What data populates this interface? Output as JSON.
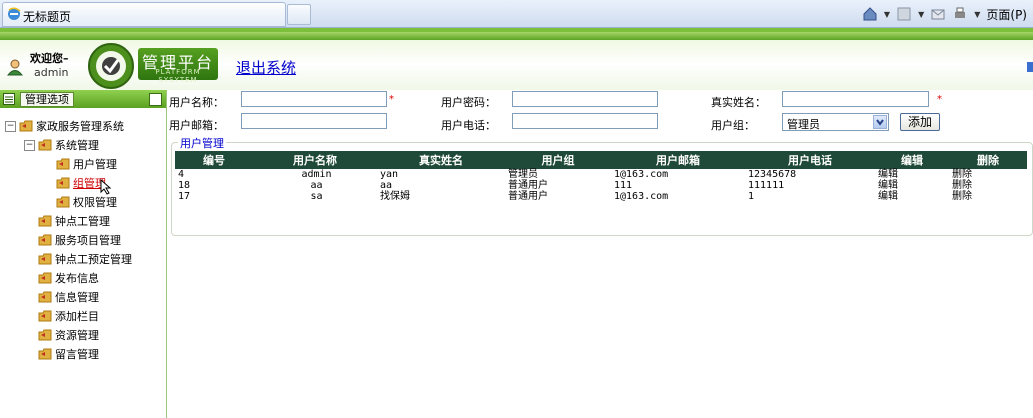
{
  "browser": {
    "tab_title": "无标题页",
    "page_menu": "页面(P)"
  },
  "header": {
    "welcome": "欢迎您–",
    "user": "admin",
    "platform_title": "管理平台",
    "platform_subtitle": "PLATFORM SYSYTEM",
    "logout": "退出系统"
  },
  "sidebar": {
    "title": "管理选项",
    "root": "家政服务管理系统",
    "system_group": "系统管理",
    "system_children": [
      "用户管理",
      "组管理",
      "权限管理"
    ],
    "items": [
      "钟点工管理",
      "服务项目管理",
      "钟点工预定管理",
      "发布信息",
      "信息管理",
      "添加栏目",
      "资源管理",
      "留言管理"
    ]
  },
  "form": {
    "username_label": "用户名称：",
    "password_label": "用户密码：",
    "realname_label": "真实姓名：",
    "email_label": "用户邮箱：",
    "phone_label": "用户电话：",
    "group_label": "用户组：",
    "required_mark": "*",
    "group_selected": "管理员",
    "add_button": "添加"
  },
  "panel": {
    "legend": "用户管理",
    "columns": [
      "编号",
      "用户名称",
      "真实姓名",
      "用户组",
      "用户邮箱",
      "用户电话",
      "编辑",
      "删除"
    ],
    "rows": [
      [
        "4",
        "admin",
        "yan",
        "管理员",
        "1@163.com",
        "12345678",
        "编辑",
        "删除"
      ],
      [
        "18",
        "aa",
        "aa",
        "普通用户",
        "111",
        "111111",
        "编辑",
        "删除"
      ],
      [
        "17",
        "sa",
        "找保姆",
        "普通用户",
        "1@163.com",
        "1",
        "编辑",
        "删除"
      ]
    ]
  },
  "colors": {
    "accent_green": "#5ba020",
    "table_header": "#1f4a3a",
    "link_blue": "#0000cc",
    "active_red": "#d00000"
  }
}
